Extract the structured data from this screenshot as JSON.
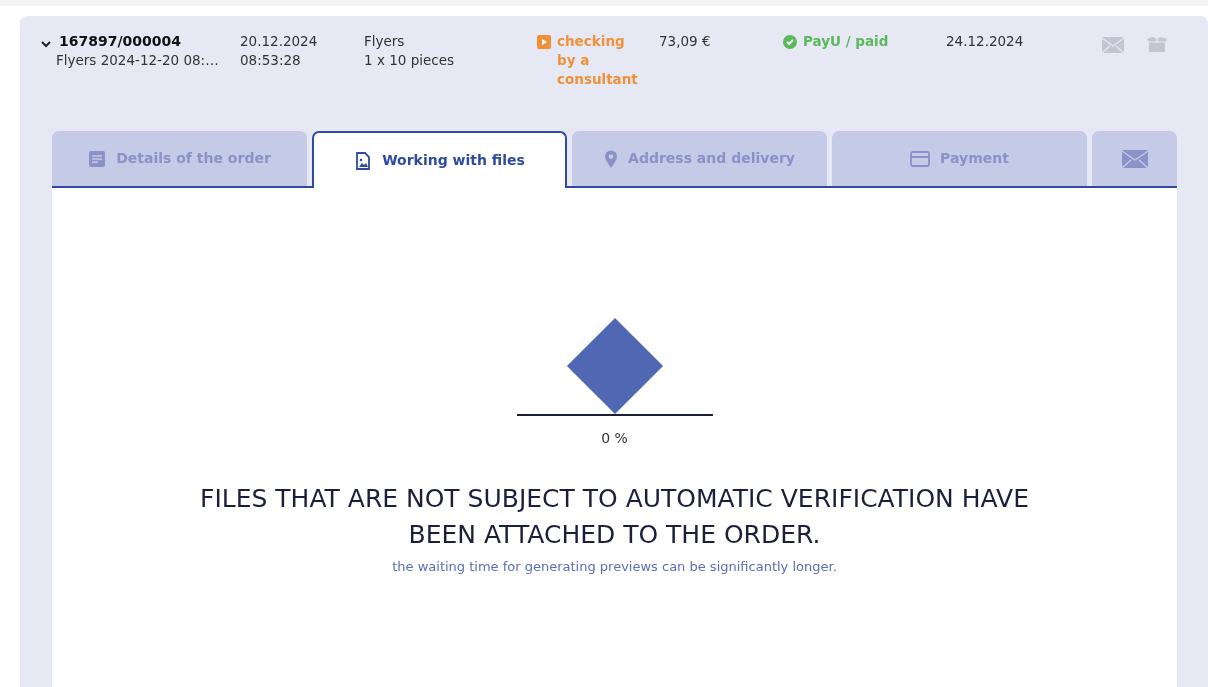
{
  "order": {
    "expanded": true,
    "number": "167897/000004",
    "name": "Flyers 2024-12-20 08:…",
    "date": "20.12.2024",
    "time": "08:53:28",
    "product": "Flyers",
    "quantity": "1 x 10 pieces",
    "status": "checking by a consultant",
    "price": "73,09 €",
    "payment": "PayU / paid",
    "delivery_date": "24.12.2024"
  },
  "tabs": [
    {
      "kind": "details",
      "label": "Details of the order",
      "selected": false
    },
    {
      "kind": "files",
      "label": "Working with files",
      "selected": true
    },
    {
      "kind": "address",
      "label": "Address and delivery",
      "selected": false
    },
    {
      "kind": "payment",
      "label": "Payment",
      "selected": false
    },
    {
      "kind": "mail",
      "selected": false
    }
  ],
  "progress": {
    "reading": "0 %"
  },
  "message": {
    "title": "FILES THAT ARE NOT SUBJECT TO AUTOMATIC VERIFICATION HAVE BEEN ATTACHED TO THE ORDER.",
    "note": "the waiting time for generating previews can be significantly longer."
  }
}
